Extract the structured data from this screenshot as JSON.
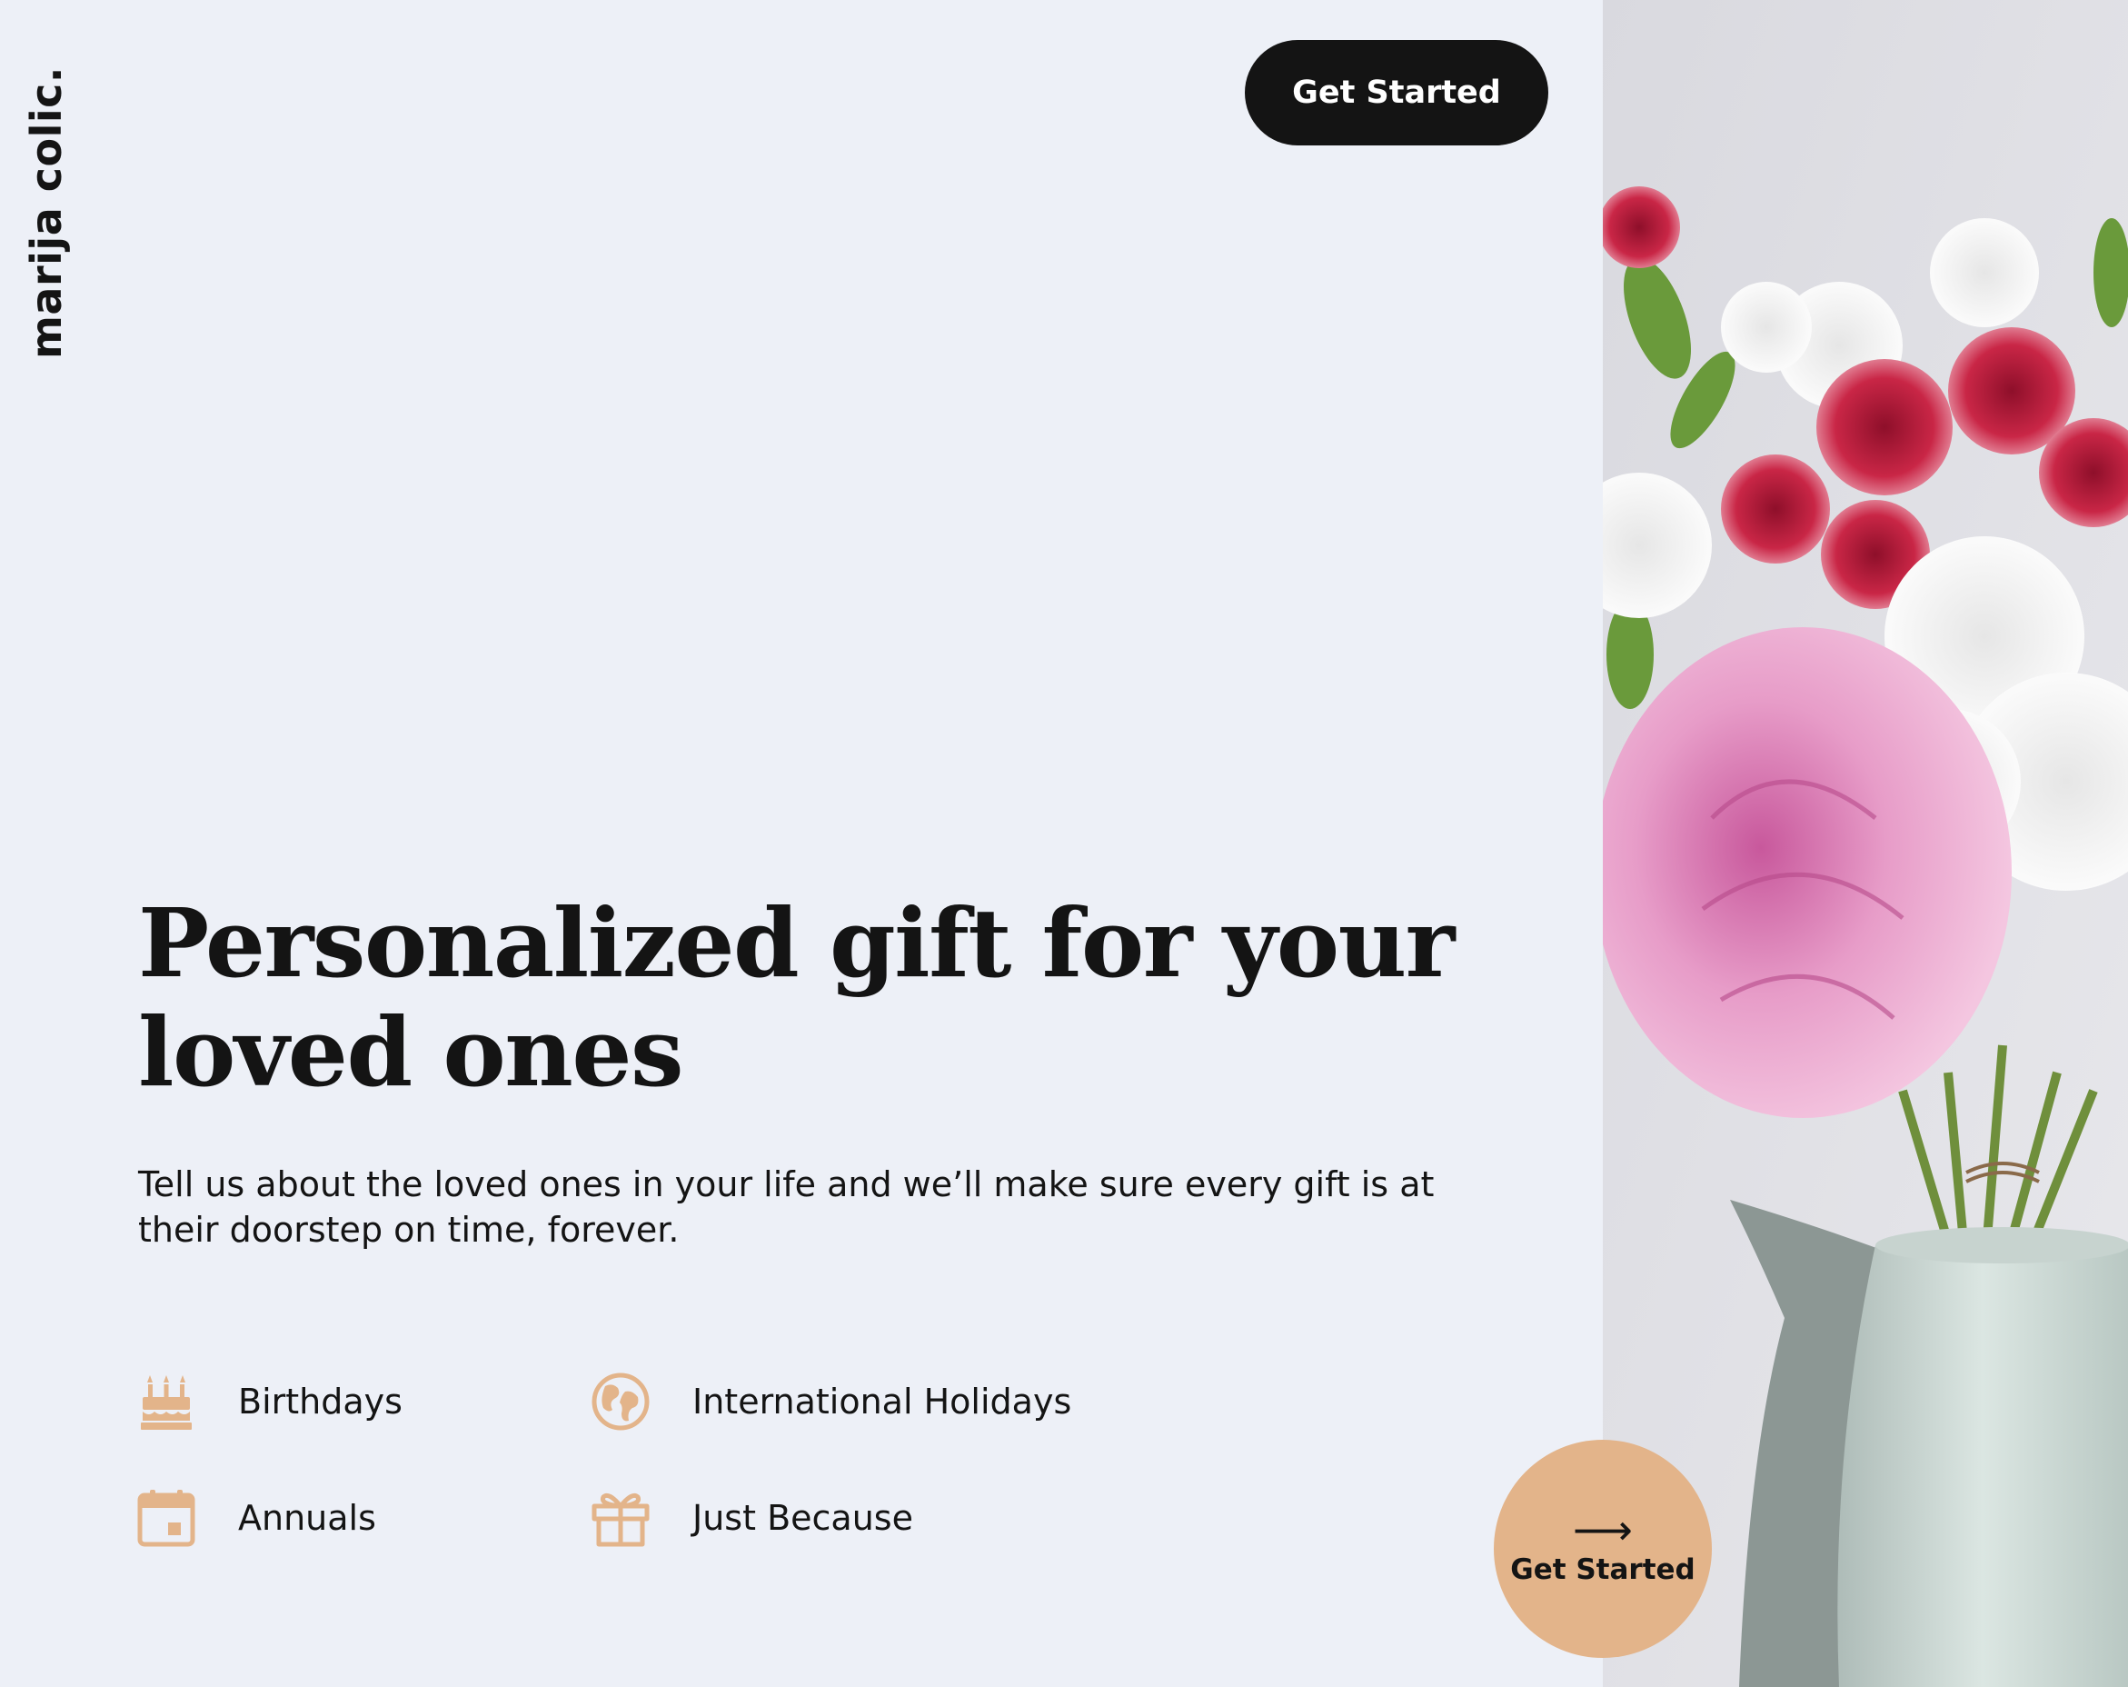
{
  "brand": {
    "name": "marija colic."
  },
  "header": {
    "cta_label": "Get Started"
  },
  "hero": {
    "headline": "Personalized gift for your loved ones",
    "subtext": "Tell us about the loved ones in your life and we’ll make sure every gift is at their doorstep on time, forever."
  },
  "features": [
    {
      "label": "Birthdays",
      "icon": "birthday-cake-icon"
    },
    {
      "label": "International Holidays",
      "icon": "globe-icon"
    },
    {
      "label": "Annuals",
      "icon": "calendar-icon"
    },
    {
      "label": "Just Because",
      "icon": "gift-icon"
    }
  ],
  "round_cta": {
    "arrow": "⟶",
    "label": "Get Started"
  },
  "colors": {
    "background": "#edf0f7",
    "dark": "#141414",
    "accent": "#e3b48a",
    "icon": "#e3b48a"
  }
}
